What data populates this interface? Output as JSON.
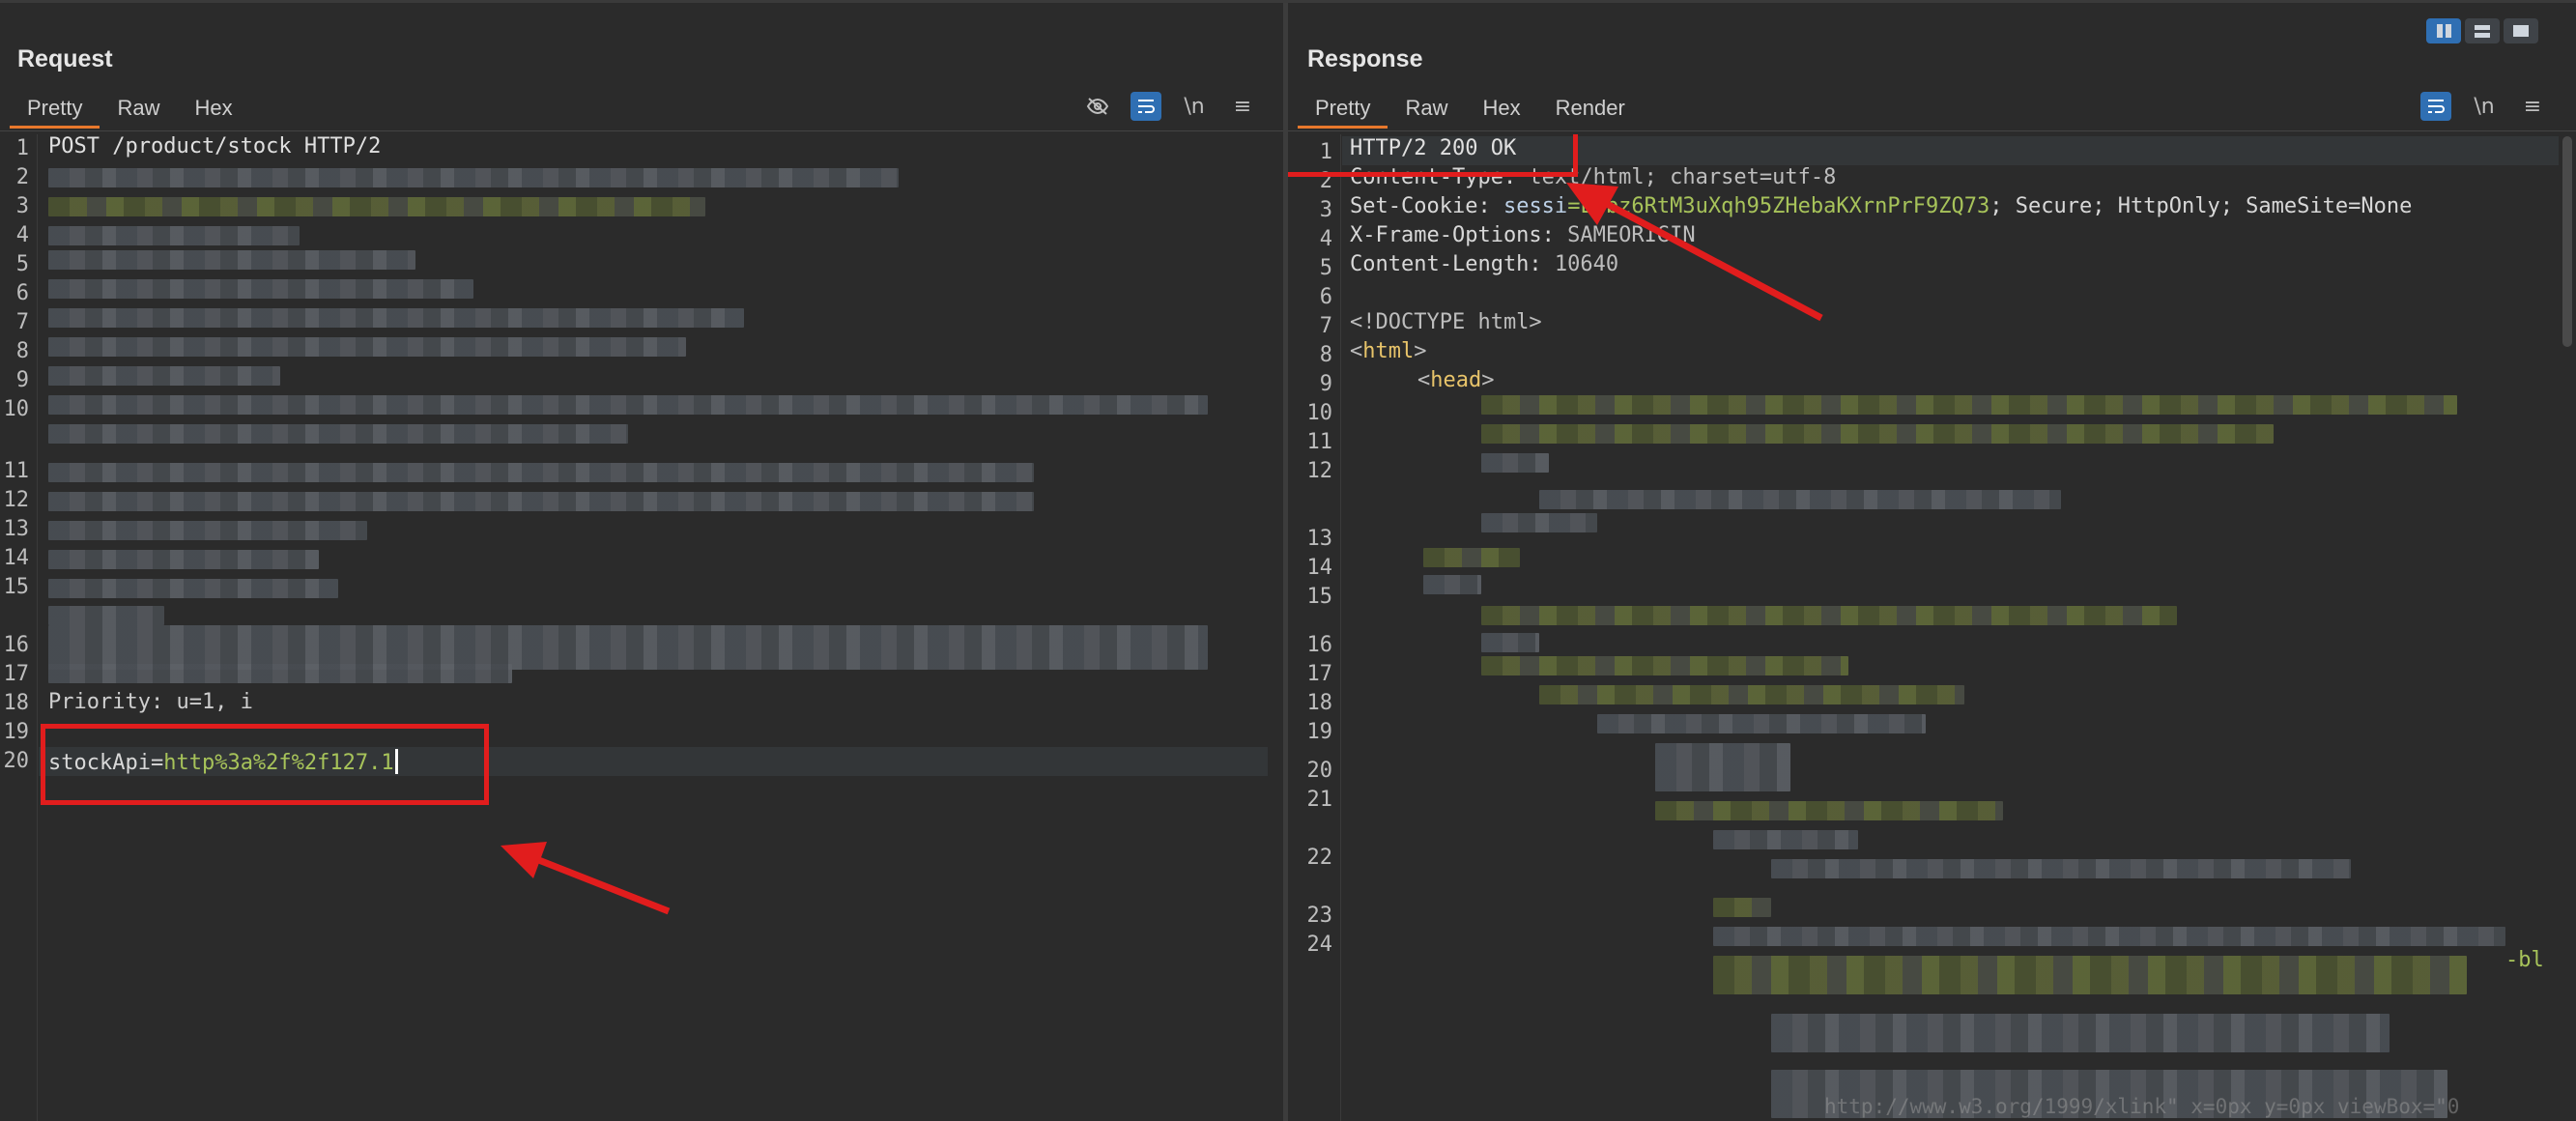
{
  "request": {
    "title": "Request",
    "tabs": [
      "Pretty",
      "Raw",
      "Hex"
    ],
    "active_tab": "Pretty",
    "toolbar": {
      "hide_icon": "eye-off-icon",
      "wrap_icon": "wrap-icon",
      "newline_label": "\\n",
      "menu_icon": "menu-icon"
    },
    "line_numbers": [
      "1",
      "2",
      "3",
      "4",
      "5",
      "6",
      "7",
      "8",
      "9",
      "10",
      "11",
      "12",
      "13",
      "14",
      "15",
      "16",
      "17",
      "18",
      "19",
      "20"
    ],
    "line1": "POST /product/stock HTTP/2",
    "line18": "Priority: u=1, i",
    "line20_key": "stockApi=",
    "line20_value": "http%3a%2f%2f127.1"
  },
  "response": {
    "title": "Response",
    "tabs": [
      "Pretty",
      "Raw",
      "Hex",
      "Render"
    ],
    "active_tab": "Pretty",
    "toolbar": {
      "wrap_icon": "wrap-icon",
      "newline_label": "\\n",
      "menu_icon": "menu-icon"
    },
    "line_numbers": [
      "1",
      "2",
      "3",
      "4",
      "5",
      "6",
      "7",
      "8",
      "9",
      "10",
      "11",
      "12",
      "13",
      "14",
      "15",
      "16",
      "17",
      "18",
      "19",
      "20",
      "21",
      "22",
      "23",
      "24"
    ],
    "line1": "HTTP/2 200 OK",
    "line2_key": "Content-Type:",
    "line2_val": " text/html; charset=utf-8",
    "line3_key": "Set-Cookie:",
    "line3_name": " sessi",
    "line3_val": "=LCbz6RtM3uXqh95ZHebaKXrnPrF9ZQ73",
    "line3_rest": "; Secure; HttpOnly; SameSite=None",
    "line4_key": "X-Frame-Options:",
    "line4_val": " SAMEORIGIN",
    "line5_key": "Content-Length:",
    "line5_val": " 10640",
    "line7": "<!DOCTYPE html>",
    "line8": "html",
    "line9": "head",
    "line22_tail": "-bl",
    "line24_tail": "http://www.w3.org/1999/xlink\" x=0px y=0px viewBox=\"0"
  },
  "layout_buttons": [
    "split-vertical-icon",
    "split-horizontal-icon",
    "single-pane-icon"
  ],
  "colors": {
    "accent_tab": "#e8782c",
    "highlight_box": "#e11d1d",
    "active_button": "#2f6fb3"
  }
}
